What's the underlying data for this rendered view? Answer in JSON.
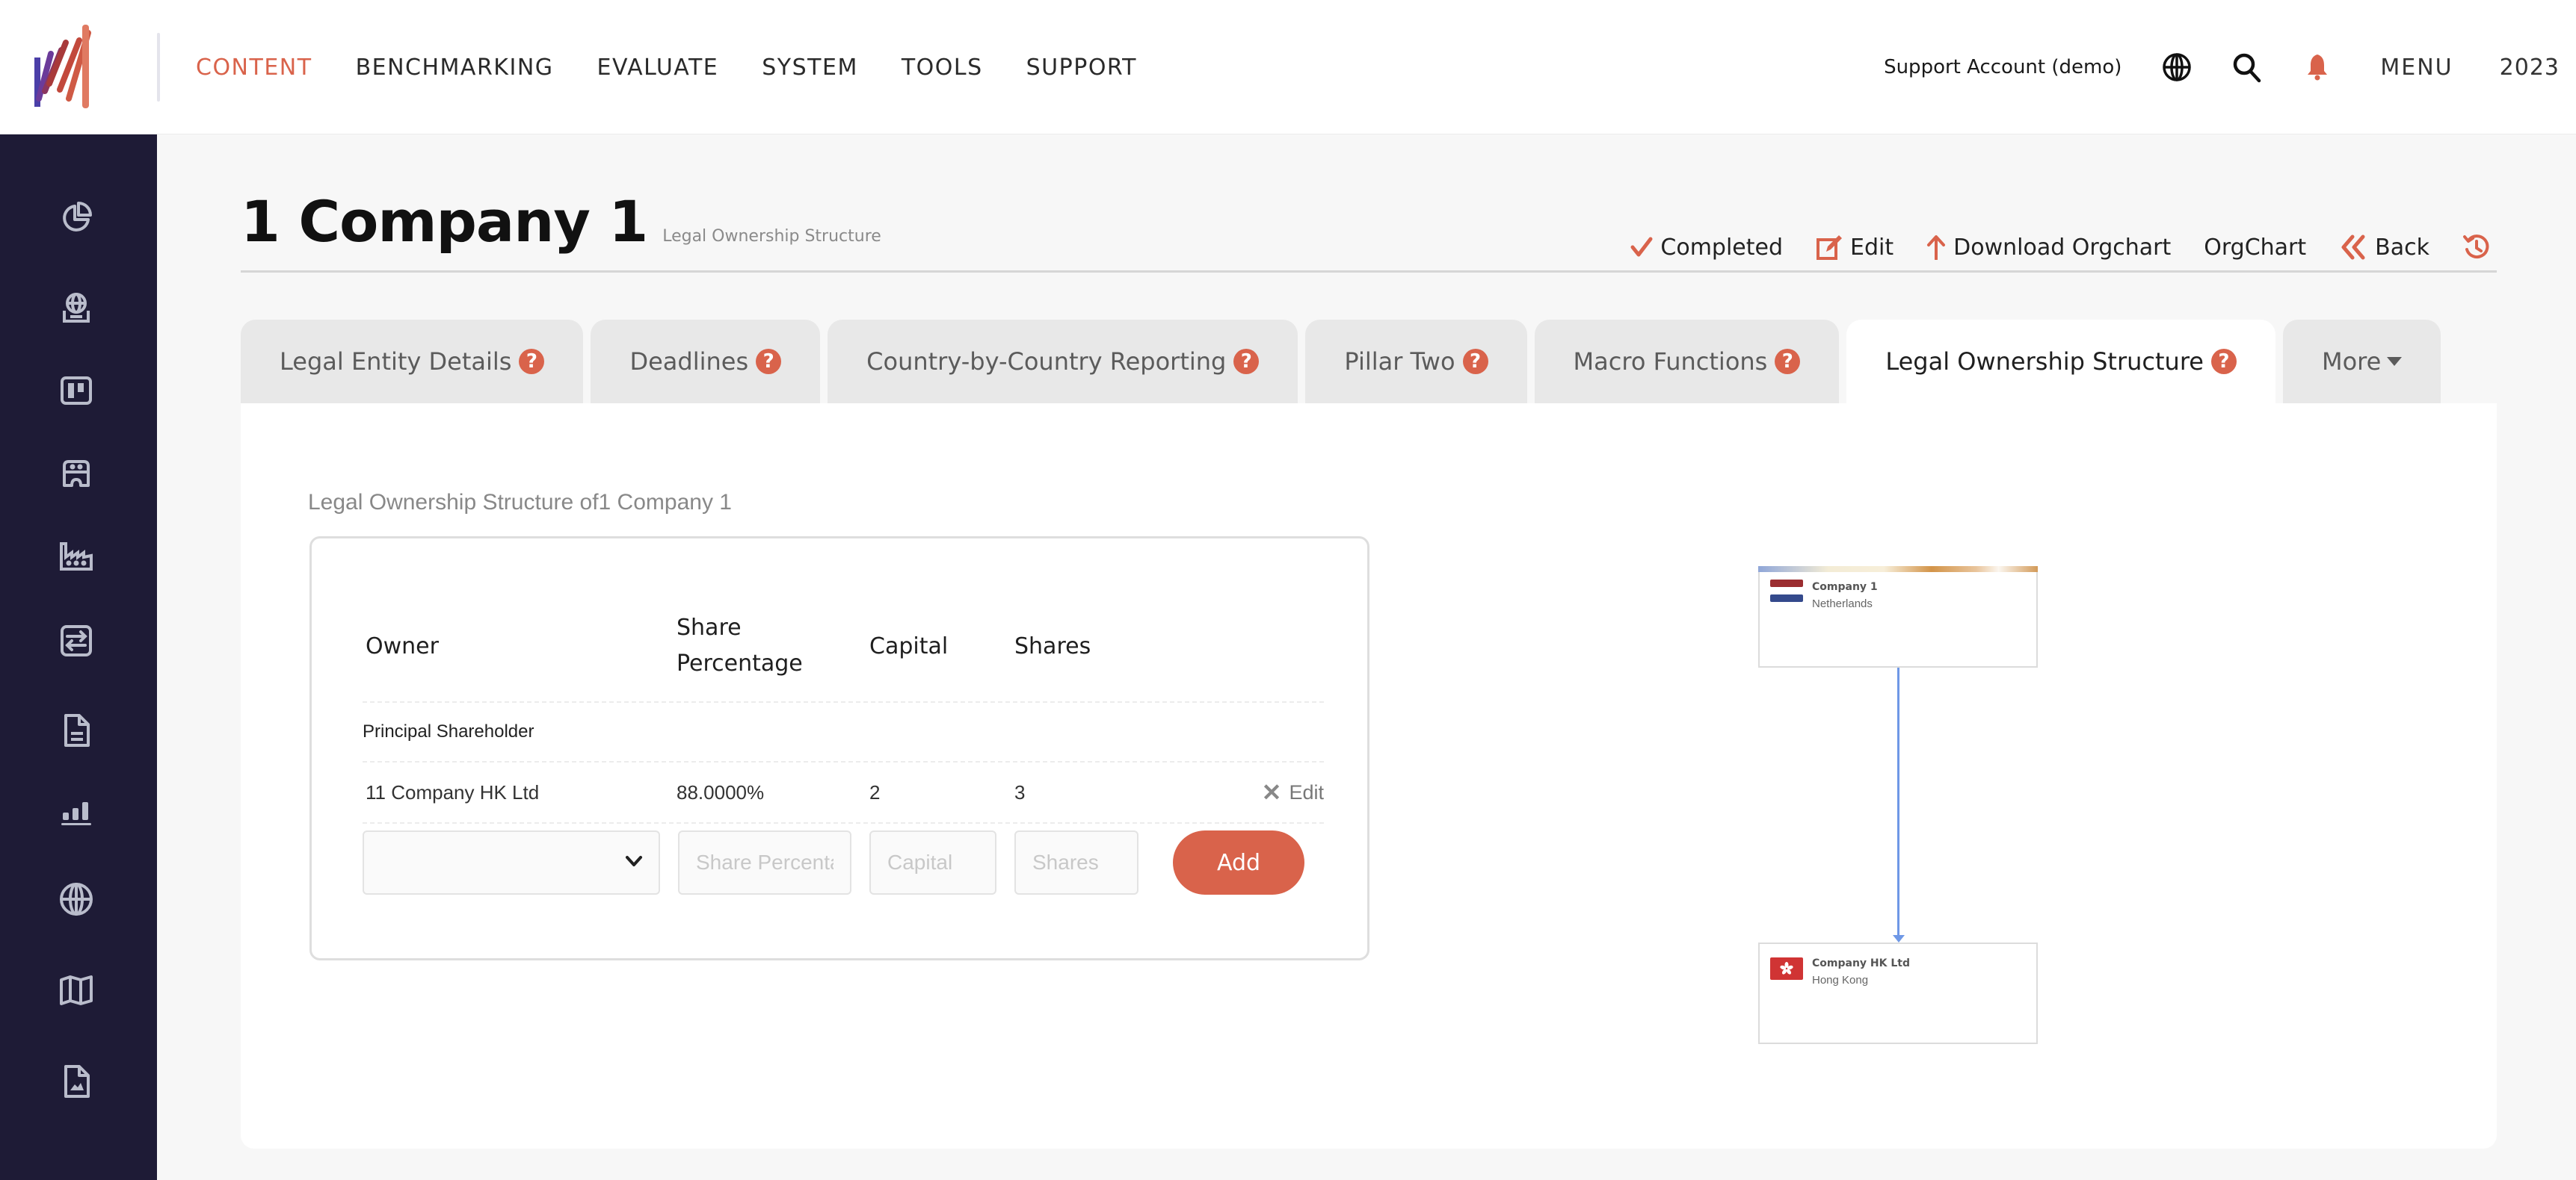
{
  "header": {
    "nav": [
      {
        "label": "CONTENT",
        "active": true
      },
      {
        "label": "BENCHMARKING",
        "active": false
      },
      {
        "label": "EVALUATE",
        "active": false
      },
      {
        "label": "SYSTEM",
        "active": false
      },
      {
        "label": "TOOLS",
        "active": false
      },
      {
        "label": "SUPPORT",
        "active": false
      }
    ],
    "account": "Support Account (demo)",
    "icons": [
      "globe-icon",
      "search-icon",
      "bell-icon"
    ],
    "menu_label": "MENU",
    "year": "2023"
  },
  "sidebar": {
    "items": [
      {
        "icon": "pie-chart-icon"
      },
      {
        "icon": "globe-stand-icon"
      },
      {
        "icon": "board-icon"
      },
      {
        "icon": "robot-icon"
      },
      {
        "icon": "factory-icon"
      },
      {
        "icon": "transfer-icon"
      },
      {
        "icon": "document-icon"
      },
      {
        "icon": "bar-chart-icon"
      },
      {
        "icon": "world-icon"
      },
      {
        "icon": "map-icon"
      },
      {
        "icon": "image-file-icon"
      }
    ]
  },
  "page": {
    "title": "1 Company 1",
    "subtitle": "Legal Ownership Structure",
    "actions": [
      {
        "label": "Completed",
        "icon": "check-icon"
      },
      {
        "label": "Edit",
        "icon": "edit-icon"
      },
      {
        "label": "Download Orgchart",
        "icon": "arrow-up-icon"
      },
      {
        "label": "OrgChart",
        "icon": ""
      },
      {
        "label": "Back",
        "icon": "double-chevron-left-icon"
      },
      {
        "label": "",
        "icon": "history-icon"
      }
    ]
  },
  "tabs": [
    {
      "label": "Legal Entity Details",
      "help": true,
      "active": false
    },
    {
      "label": "Deadlines",
      "help": true,
      "active": false
    },
    {
      "label": "Country-by-Country Reporting",
      "help": true,
      "active": false
    },
    {
      "label": "Pillar Two",
      "help": true,
      "active": false
    },
    {
      "label": "Macro Functions",
      "help": true,
      "active": false
    },
    {
      "label": "Legal Ownership Structure",
      "help": true,
      "active": true
    },
    {
      "label": "More",
      "help": false,
      "active": false
    }
  ],
  "help_glyph": "?",
  "ownership": {
    "section_title": "Legal Ownership Structure of1 Company 1",
    "columns": {
      "owner": "Owner",
      "share_pct_line1": "Share",
      "share_pct_line2": "Percentage",
      "capital": "Capital",
      "shares": "Shares"
    },
    "group_label": "Principal Shareholder",
    "rows": [
      {
        "owner": "11 Company HK Ltd",
        "share_pct": "88.0000%",
        "capital": "2",
        "shares": "3",
        "action": "Edit"
      }
    ],
    "add_form": {
      "owner_select_value": "",
      "share_pct_placeholder": "Share Percentage",
      "capital_placeholder": "Capital",
      "shares_placeholder": "Shares",
      "add_label": "Add"
    }
  },
  "orgchart": {
    "nodes": [
      {
        "name": "Company 1",
        "country": "Netherlands",
        "flag": "netherlands-flag"
      },
      {
        "name": "Company HK Ltd",
        "country": "Hong Kong",
        "flag": "hong-kong-flag"
      }
    ],
    "links": [
      {
        "from": "Company HK Ltd",
        "to": "Company 1"
      }
    ]
  },
  "colors": {
    "accent": "#d9634b",
    "sidebar_bg": "#1e1b36",
    "sidebar_icon": "#b9bccb",
    "link": "#6f98e6"
  }
}
